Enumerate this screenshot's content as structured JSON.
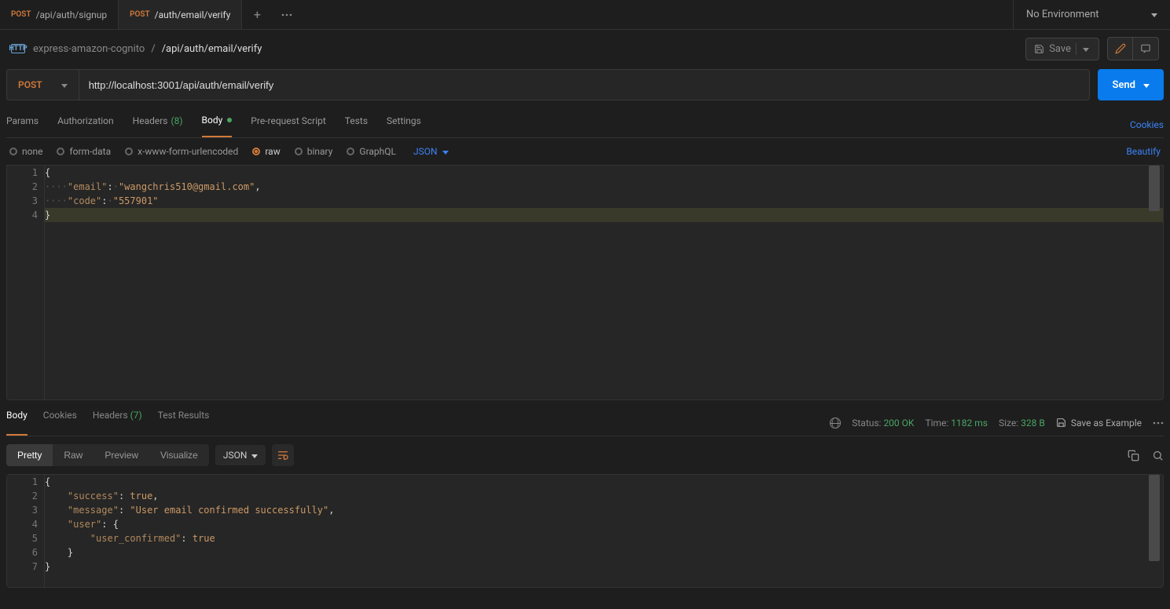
{
  "tabs": [
    {
      "method": "POST",
      "path": "/api/auth/signup",
      "active": false
    },
    {
      "method": "POST",
      "path": "/auth/email/verify",
      "active": true
    }
  ],
  "env": {
    "label": "No Environment"
  },
  "breadcrumb": {
    "workspace": "express-amazon-cognito",
    "sep": "/",
    "current": "/api/auth/email/verify"
  },
  "actions": {
    "save": "Save"
  },
  "request": {
    "method": "POST",
    "url": "http://localhost:3001/api/auth/email/verify",
    "send": "Send"
  },
  "reqTabs": {
    "params": "Params",
    "auth": "Authorization",
    "headers_label": "Headers",
    "headers_count": "(8)",
    "body": "Body",
    "prereq": "Pre-request Script",
    "tests": "Tests",
    "settings": "Settings",
    "cookies": "Cookies"
  },
  "bodyTypes": {
    "none": "none",
    "form": "form-data",
    "urlenc": "x-www-form-urlencoded",
    "raw": "raw",
    "binary": "binary",
    "graphql": "GraphQL",
    "json": "JSON",
    "beautify": "Beautify"
  },
  "reqBody": {
    "l1": "{",
    "l2_key": "\"email\"",
    "l2_val": "\"wangchris510@gmail.com\"",
    "l3_key": "\"code\"",
    "l3_val": "\"557901\"",
    "l4": "}"
  },
  "respTabs": {
    "body": "Body",
    "cookies": "Cookies",
    "headers_label": "Headers",
    "headers_count": "(7)",
    "tests": "Test Results"
  },
  "respMeta": {
    "status_label": "Status:",
    "status_value": "200 OK",
    "time_label": "Time:",
    "time_value": "1182 ms",
    "size_label": "Size:",
    "size_value": "328 B",
    "save_example": "Save as Example"
  },
  "viewModes": {
    "pretty": "Pretty",
    "raw": "Raw",
    "preview": "Preview",
    "visualize": "Visualize",
    "json": "JSON"
  },
  "respBody": {
    "l1": "{",
    "l2_key": "\"success\"",
    "l2_val": "true",
    "l3_key": "\"message\"",
    "l3_val": "\"User email confirmed successfully\"",
    "l4_key": "\"user\"",
    "l4_val": "{",
    "l5_key": "\"user_confirmed\"",
    "l5_val": "true",
    "l6": "}",
    "l7": "}"
  }
}
